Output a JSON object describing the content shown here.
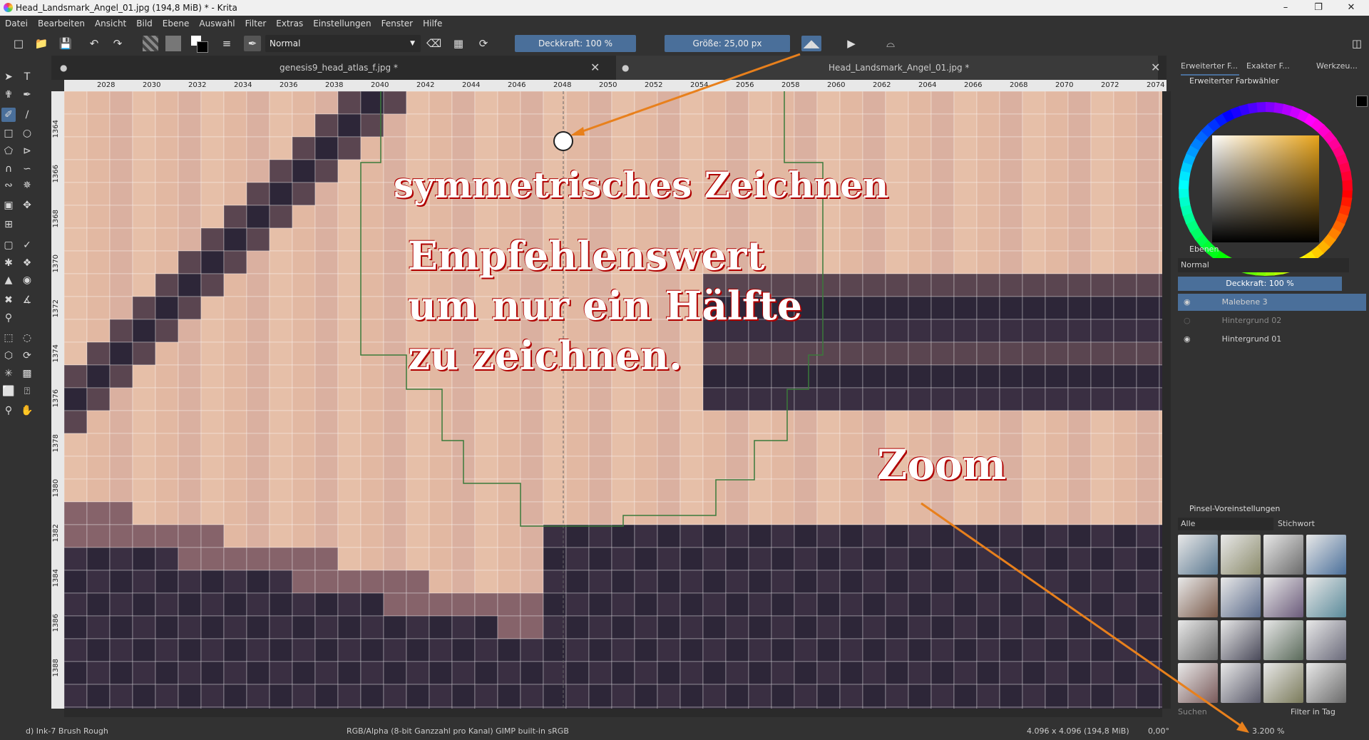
{
  "window": {
    "title": "Head_Landsmark_Angel_01.jpg (194,8 MiB)  * - Krita"
  },
  "menu": [
    "Datei",
    "Bearbeiten",
    "Ansicht",
    "Bild",
    "Ebene",
    "Auswahl",
    "Filter",
    "Extras",
    "Einstellungen",
    "Fenster",
    "Hilfe"
  ],
  "toolbar": {
    "blend_mode": "Normal",
    "opacity": "Deckkraft: 100 %",
    "size": "Größe: 25,00 px"
  },
  "tabs": [
    {
      "label": "genesis9_head_atlas_f.jpg *"
    },
    {
      "label": "Head_Landsmark_Angel_01.jpg *"
    }
  ],
  "ruler": {
    "h": [
      "2028",
      "2030",
      "2032",
      "2034",
      "2036",
      "2038",
      "2040",
      "2042",
      "2044",
      "2046",
      "2048",
      "2050",
      "2052",
      "2054",
      "2056",
      "2058",
      "2060",
      "2062",
      "2064",
      "2066",
      "2068",
      "2070",
      "2072",
      "2074"
    ],
    "v": [
      "1364",
      "1366",
      "1368",
      "1370",
      "1372",
      "1374",
      "1376",
      "1378",
      "1380",
      "1382",
      "1384",
      "1386",
      "1388"
    ]
  },
  "annotations": {
    "symmetry": "symmetrisches Zeichnen",
    "rec1": "Empfehlenswert",
    "rec2": "um nur ein Hälfte",
    "rec3": "zu zeichnen.",
    "zoom": "Zoom"
  },
  "dock": {
    "tabs": [
      "Erweiterter F...",
      "Exakter F...",
      "Werkzeu..."
    ],
    "color_selector_title": "Erweiterter Farbwähler",
    "layers_title": "Ebenen",
    "layers_blend": "Normal",
    "layers_opacity": "Deckkraft:  100 %",
    "layers": [
      {
        "name": "Malebene 3",
        "visible": true,
        "selected": true
      },
      {
        "name": "Hintergrund 02",
        "visible": false,
        "selected": false
      },
      {
        "name": "Hintergrund 01",
        "visible": true,
        "selected": false
      }
    ],
    "presets_title": "Pinsel-Voreinstellungen",
    "presets_filter": "Alle",
    "presets_tag": "Stichwort",
    "presets_search": "Suchen",
    "filter_in_tag": "Filter in Tag"
  },
  "status": {
    "brush": "d) Ink-7 Brush Rough",
    "color": "RGB/Alpha (8-bit Ganzzahl pro Kanal)  GIMP built-in sRGB",
    "dims": "4.096 x 4.096 (194,8 MiB)",
    "rotation": "0,00°",
    "zoom": "3.200 %"
  },
  "colors": {
    "accent": "#4a6f9a",
    "arrow": "#e8801c",
    "skin": "#e6bfa8",
    "dark": "#2d2638"
  }
}
